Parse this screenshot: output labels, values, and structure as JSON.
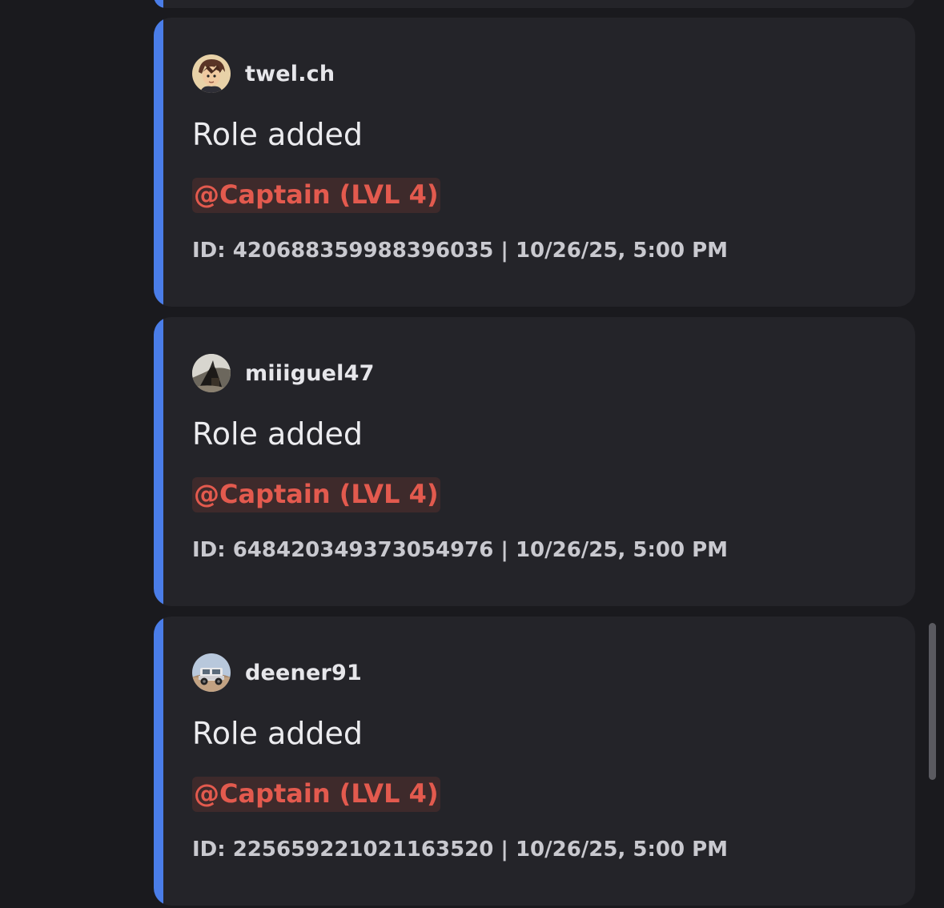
{
  "entries": [
    {
      "author": "twel.ch",
      "avatar": "anime-character-avatar",
      "title": "Role added",
      "mention": "@Captain (LVL 4)",
      "footer": "ID: 420688359988396035 | 10/26/25, 5:00 PM"
    },
    {
      "author": "miiiguel47",
      "avatar": "dark-photo-avatar",
      "title": "Role added",
      "mention": "@Captain (LVL 4)",
      "footer": "ID: 648420349373054976 | 10/26/25, 5:00 PM"
    },
    {
      "author": "deener91",
      "avatar": "jeep-photo-avatar",
      "title": "Role added",
      "mention": "@Captain (LVL 4)",
      "footer": "ID: 225659221021163520 | 10/26/25, 5:00 PM"
    }
  ],
  "colors": {
    "background": "#1a1a1e",
    "embed_background": "#242429",
    "accent_bar": "#4a7de8",
    "mention_text": "#e35a4e",
    "mention_background": "#3e2a2b"
  }
}
